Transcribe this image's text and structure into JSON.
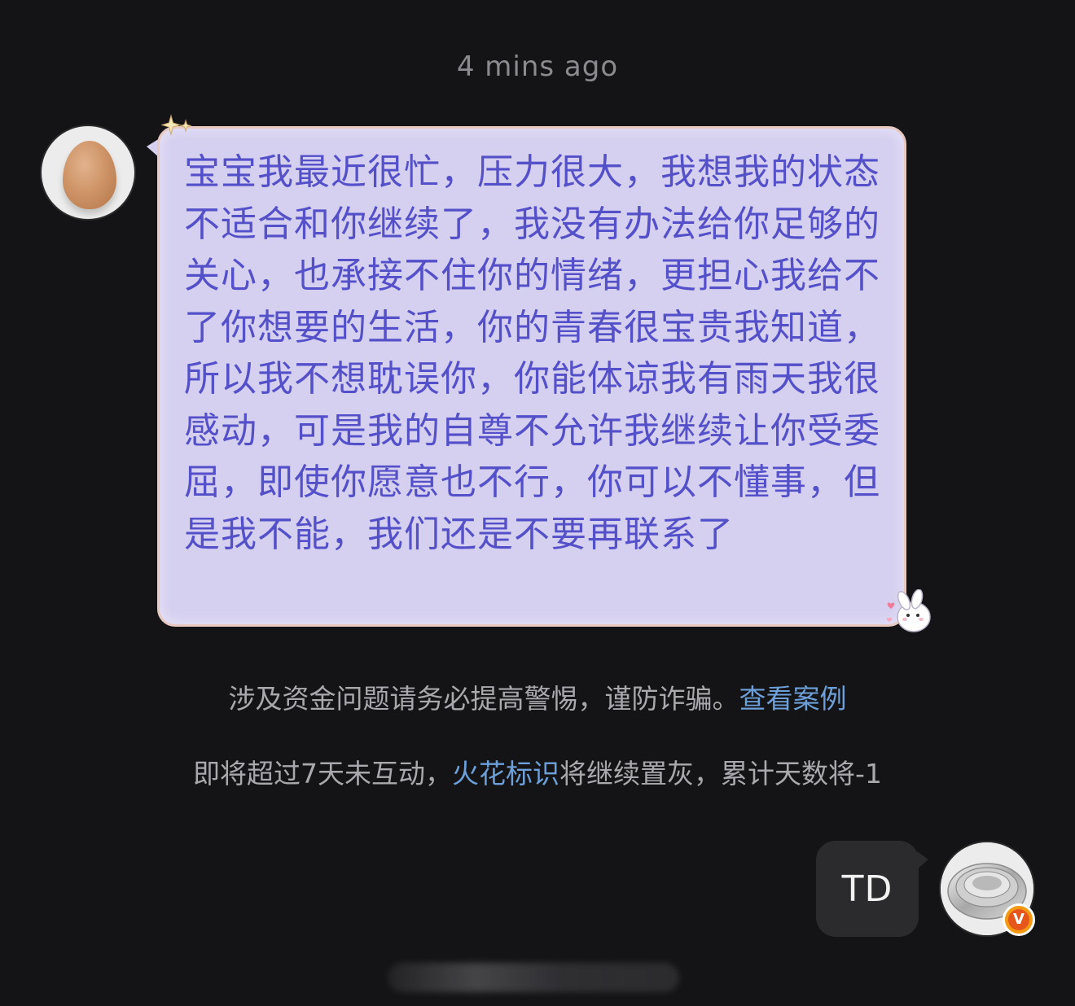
{
  "timestamp": "4 mins ago",
  "incoming_message": {
    "text": "宝宝我最近很忙，压力很大，我想我的状态不适合和你继续了，我没有办法给你足够的关心，也承接不住你的情绪，更担心我给不了你想要的生活，你的青春很宝贵我知道，所以我不想耽误你，你能体谅我有雨天我很感动，可是我的自尊不允许我继续让你受委屈，即使你愿意也不行，你可以不懂事，但是我不能，我们还是不要再联系了",
    "avatar_icon": "egg-avatar-icon",
    "bubble_color": "#d5cff0",
    "text_color": "#5450c9"
  },
  "notices": {
    "fraud_warning": "涉及资金问题请务必提高警惕，谨防诈骗。",
    "fraud_link": "查看案例",
    "spark_prefix": "即将超过7天未互动，",
    "spark_link": "火花标识",
    "spark_suffix": "将继续置灰，累计天数将-1",
    "link_color": "#6d9fd8"
  },
  "outgoing_message": {
    "text": "TD",
    "avatar_icon": "steel-bowls-avatar-icon",
    "badge_icon": "verified-v-badge-icon",
    "badge_label": "V"
  }
}
